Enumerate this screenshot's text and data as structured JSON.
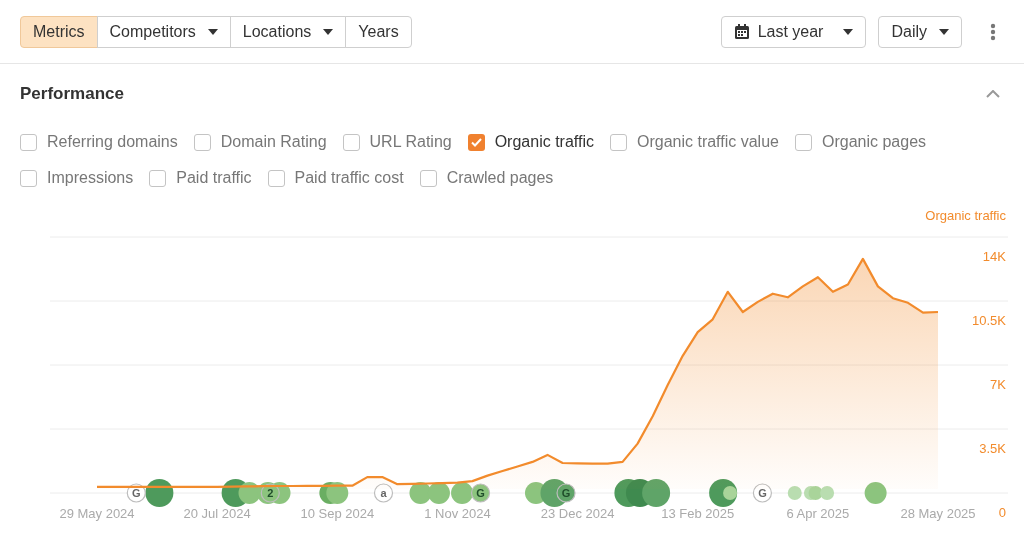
{
  "toolbar": {
    "segments": [
      {
        "label": "Metrics",
        "selected": true,
        "has_menu": false
      },
      {
        "label": "Competitors",
        "selected": false,
        "has_menu": true
      },
      {
        "label": "Locations",
        "selected": false,
        "has_menu": true
      },
      {
        "label": "Years",
        "selected": false,
        "has_menu": false
      }
    ],
    "date_range": {
      "label": "Last year",
      "has_menu": true
    },
    "interval": {
      "label": "Daily",
      "has_menu": true
    }
  },
  "performance": {
    "title": "Performance",
    "expanded": true,
    "metrics": [
      {
        "label": "Referring domains",
        "checked": false
      },
      {
        "label": "Domain Rating",
        "checked": false
      },
      {
        "label": "URL Rating",
        "checked": false
      },
      {
        "label": "Organic traffic",
        "checked": true
      },
      {
        "label": "Organic traffic value",
        "checked": false
      },
      {
        "label": "Organic pages",
        "checked": false
      },
      {
        "label": "Impressions",
        "checked": false
      },
      {
        "label": "Paid traffic",
        "checked": false
      },
      {
        "label": "Paid traffic cost",
        "checked": false
      },
      {
        "label": "Crawled pages",
        "checked": false
      }
    ],
    "chart_data": {
      "type": "area",
      "categories": [
        "29 May 2024",
        null,
        null,
        null,
        null,
        null,
        null,
        null,
        "20 Jul 2024",
        null,
        null,
        null,
        null,
        null,
        null,
        null,
        "10 Sep 2024",
        null,
        null,
        null,
        null,
        null,
        null,
        null,
        "1 Nov 2024",
        null,
        null,
        null,
        null,
        null,
        null,
        null,
        "23 Dec 2024",
        null,
        null,
        null,
        null,
        null,
        null,
        null,
        "13 Feb 2025",
        null,
        null,
        null,
        null,
        null,
        null,
        null,
        "6 Apr 2025",
        null,
        null,
        null,
        null,
        null,
        null,
        null,
        "28 May 2025"
      ],
      "series": [
        {
          "name": "Organic traffic",
          "color": "#f28b2c",
          "values": [
            1370,
            1370,
            1370,
            1370,
            1370,
            1370,
            1370,
            1370,
            1380,
            1390,
            1400,
            1410,
            1420,
            1420,
            1430,
            1430,
            1440,
            1440,
            1910,
            1910,
            1520,
            1540,
            1560,
            1580,
            1610,
            1690,
            1990,
            2240,
            2490,
            2740,
            3120,
            2680,
            2660,
            2640,
            2640,
            2740,
            3740,
            5240,
            6940,
            8540,
            9840,
            10540,
            12040,
            10940,
            11490,
            11940,
            11740,
            12340,
            12840,
            12040,
            12440,
            13840,
            12340,
            11690,
            11440,
            10900,
            10940
          ]
        }
      ],
      "ylim": [
        0,
        14000
      ],
      "yticks": [
        {
          "value": 0,
          "label": "0"
        },
        {
          "value": 3500,
          "label": "3.5K"
        },
        {
          "value": 7000,
          "label": "7K"
        },
        {
          "value": 10500,
          "label": "10.5K"
        },
        {
          "value": 14000,
          "label": "14K"
        }
      ]
    },
    "events": [
      {
        "kind": "letter",
        "label": "G",
        "color": "#ffffff"
      },
      {
        "kind": "large",
        "color": "#4e9a5c"
      },
      {
        "kind": "large",
        "color": "#4e9a5c"
      },
      {
        "kind": "medium",
        "color": "#8cc47e"
      },
      {
        "kind": "medium",
        "color": "#8cc47e"
      },
      {
        "kind": "letter",
        "label": "2",
        "color": "#8cc47e"
      },
      {
        "kind": "medium",
        "color": "#8cc47e"
      },
      {
        "kind": "medium",
        "color": "#6aae62"
      },
      {
        "kind": "medium",
        "color": "#8cc47e"
      },
      {
        "kind": "letter",
        "label": "a",
        "color": "#ffffff"
      },
      {
        "kind": "medium",
        "color": "#8cc47e"
      },
      {
        "kind": "medium",
        "color": "#8cc47e"
      },
      {
        "kind": "medium",
        "color": "#8cc47e"
      },
      {
        "kind": "letter",
        "label": "G",
        "color": "#8cc47e"
      },
      {
        "kind": "medium",
        "color": "#8cc47e"
      },
      {
        "kind": "large",
        "color": "#5fa468"
      },
      {
        "kind": "letter",
        "label": "G",
        "color": "#5fa468"
      },
      {
        "kind": "large",
        "color": "#4e9a5c"
      },
      {
        "kind": "large",
        "color": "#3f8a4f"
      },
      {
        "kind": "large",
        "color": "#5fa468"
      },
      {
        "kind": "large",
        "color": "#4e9a5c"
      },
      {
        "kind": "small",
        "color": "#a9d49a"
      },
      {
        "kind": "letter",
        "label": "G",
        "color": "#ffffff"
      },
      {
        "kind": "small",
        "color": "#b9ddb0"
      },
      {
        "kind": "small",
        "color": "#b9ddb0"
      },
      {
        "kind": "small",
        "color": "#a9d49a"
      },
      {
        "kind": "small",
        "color": "#b9ddb0"
      },
      {
        "kind": "medium",
        "color": "#8cc47e"
      }
    ]
  }
}
